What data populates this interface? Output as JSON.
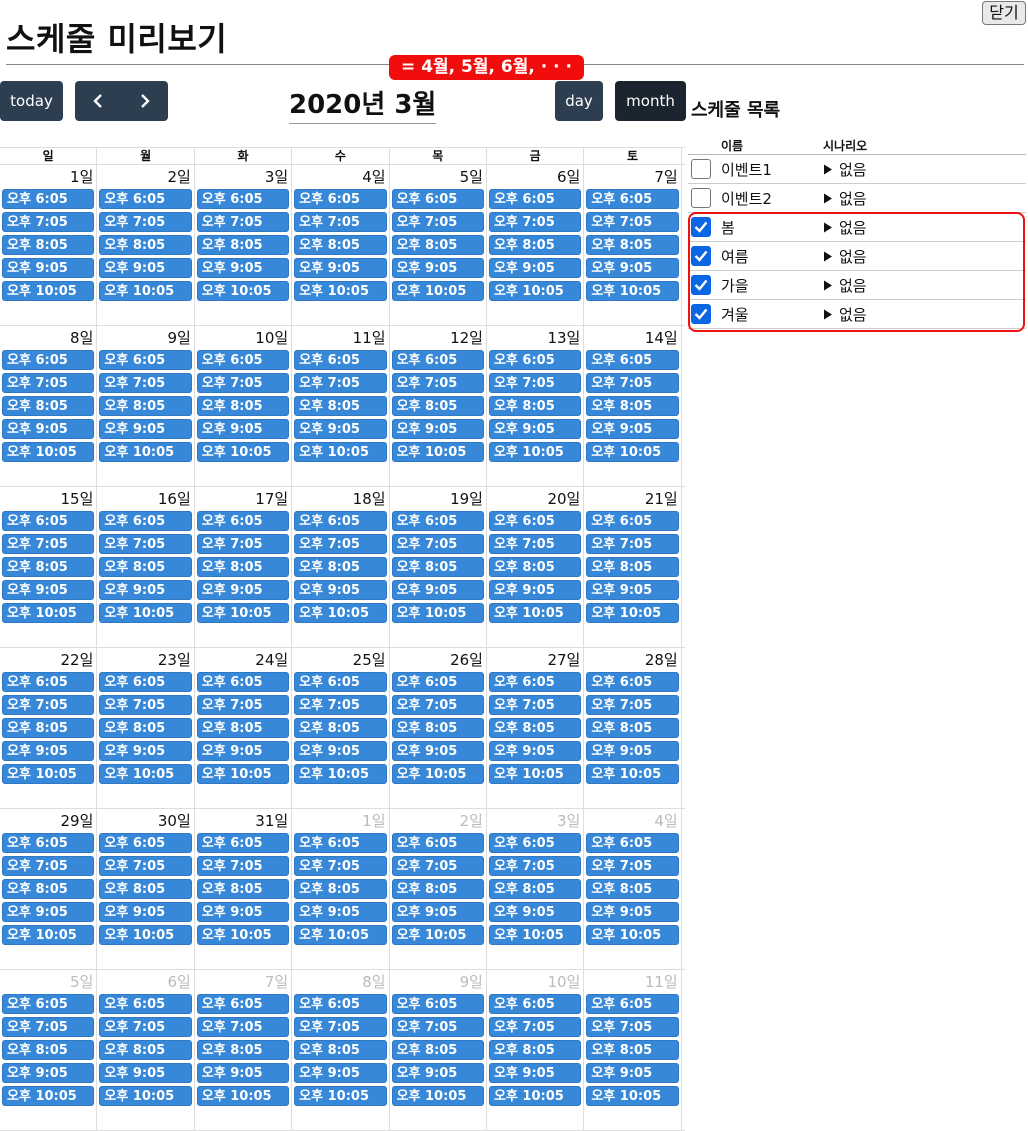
{
  "header": {
    "title": "스케줄 미리보기",
    "close_label": "닫기"
  },
  "toolbar": {
    "today_label": "today",
    "day_label": "day",
    "month_label": "month",
    "month_title": "2020년 3월",
    "annotation": "= 4월, 5월, 6월, · · ·"
  },
  "calendar": {
    "weekdays": [
      "일",
      "월",
      "화",
      "수",
      "목",
      "금",
      "토"
    ],
    "weeks": [
      [
        {
          "n": "1일",
          "o": false
        },
        {
          "n": "2일",
          "o": false
        },
        {
          "n": "3일",
          "o": false
        },
        {
          "n": "4일",
          "o": false
        },
        {
          "n": "5일",
          "o": false
        },
        {
          "n": "6일",
          "o": false
        },
        {
          "n": "7일",
          "o": false
        }
      ],
      [
        {
          "n": "8일",
          "o": false
        },
        {
          "n": "9일",
          "o": false
        },
        {
          "n": "10일",
          "o": false
        },
        {
          "n": "11일",
          "o": false
        },
        {
          "n": "12일",
          "o": false
        },
        {
          "n": "13일",
          "o": false
        },
        {
          "n": "14일",
          "o": false
        }
      ],
      [
        {
          "n": "15일",
          "o": false
        },
        {
          "n": "16일",
          "o": false
        },
        {
          "n": "17일",
          "o": false
        },
        {
          "n": "18일",
          "o": false
        },
        {
          "n": "19일",
          "o": false
        },
        {
          "n": "20일",
          "o": false
        },
        {
          "n": "21일",
          "o": false
        }
      ],
      [
        {
          "n": "22일",
          "o": false
        },
        {
          "n": "23일",
          "o": false
        },
        {
          "n": "24일",
          "o": false
        },
        {
          "n": "25일",
          "o": false
        },
        {
          "n": "26일",
          "o": false
        },
        {
          "n": "27일",
          "o": false
        },
        {
          "n": "28일",
          "o": false
        }
      ],
      [
        {
          "n": "29일",
          "o": false
        },
        {
          "n": "30일",
          "o": false
        },
        {
          "n": "31일",
          "o": false
        },
        {
          "n": "1일",
          "o": true
        },
        {
          "n": "2일",
          "o": true
        },
        {
          "n": "3일",
          "o": true
        },
        {
          "n": "4일",
          "o": true
        }
      ],
      [
        {
          "n": "5일",
          "o": true
        },
        {
          "n": "6일",
          "o": true
        },
        {
          "n": "7일",
          "o": true
        },
        {
          "n": "8일",
          "o": true
        },
        {
          "n": "9일",
          "o": true
        },
        {
          "n": "10일",
          "o": true
        },
        {
          "n": "11일",
          "o": true
        }
      ]
    ],
    "event_times": [
      "오후 6:05",
      "오후 7:05",
      "오후 8:05",
      "오후 9:05",
      "오후 10:05"
    ],
    "event_color": "#3788d8"
  },
  "schedule_list": {
    "title": "스케줄 목록",
    "col_name": "이름",
    "col_scenario": "시나리오",
    "scenario_icon": "triangle-right-icon",
    "items": [
      {
        "name": "이벤트1",
        "scenario": "없음",
        "checked": false
      },
      {
        "name": "이벤트2",
        "scenario": "없음",
        "checked": false
      },
      {
        "name": "봄",
        "scenario": "없음",
        "checked": true
      },
      {
        "name": "여름",
        "scenario": "없음",
        "checked": true
      },
      {
        "name": "가을",
        "scenario": "없음",
        "checked": true
      },
      {
        "name": "겨울",
        "scenario": "없음",
        "checked": true
      }
    ]
  }
}
